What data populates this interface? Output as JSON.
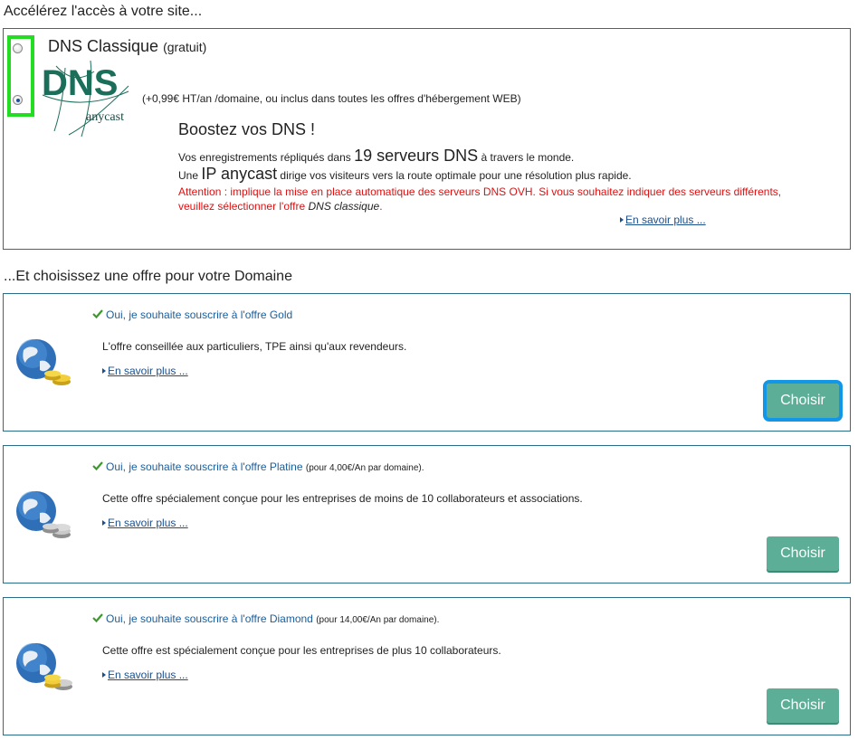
{
  "section1_title": "Accélérez l'accès à votre site...",
  "dns": {
    "classic_label": "DNS Classique",
    "classic_free": "(gratuit)",
    "logo_text": "DNS",
    "logo_sub": "anycast",
    "anycast_price": "(+0,99€ HT/an /domaine, ou inclus dans toutes les offres d'hébergement WEB)",
    "boost_title": "Boostez vos DNS !",
    "line1_prefix": "Vos enregistrements répliqués dans",
    "line1_big": "19 serveurs DNS",
    "line1_suffix": "à travers le monde.",
    "line2_prefix": "Une",
    "line2_big": "IP anycast",
    "line2_suffix": "dirige vos visiteurs vers la route optimale pour une résolution plus rapide.",
    "warn1": "Attention : implique la mise en place automatique des serveurs DNS OVH. Si vous souhaitez indiquer des serveurs différents,",
    "warn2_prefix": "veuillez sélectionner l'offre",
    "warn2_em": "DNS classique",
    "warn2_suffix": ".",
    "more": "En savoir plus ...",
    "selected": "anycast"
  },
  "section2_title": "...Et choisissez une offre pour votre Domaine",
  "offers": [
    {
      "subscribe": "Oui, je souhaite souscrire à l'offre Gold",
      "price": "",
      "description": "L'offre conseillée aux particuliers, TPE ainsi qu'aux revendeurs.",
      "more": "En savoir plus ...",
      "button": "Choisir"
    },
    {
      "subscribe": "Oui, je souhaite souscrire à l'offre Platine",
      "price": "(pour 4,00€/An par domaine).",
      "description": "Cette offre spécialement conçue pour les entreprises de moins de 10 collaborateurs et associations.",
      "more": "En savoir plus ...",
      "button": "Choisir"
    },
    {
      "subscribe": "Oui, je souhaite souscrire à l'offre Diamond",
      "price": "(pour 14,00€/An par domaine).",
      "description": "Cette offre est spécialement conçue pour les entreprises de plus 10 collaborateurs.",
      "more": "En savoir plus ...",
      "button": "Choisir"
    }
  ],
  "colors": {
    "accent_button": "#5cae96",
    "link": "#1a4e8c",
    "warning": "#dd1111",
    "border": "#2a6e8a",
    "focus_blue": "#1196e8",
    "highlight_green": "#22dd22"
  },
  "icons": [
    "radio-icon",
    "dns-anycast-logo",
    "check-icon",
    "arrow-icon",
    "globe-coins-gold-icon",
    "globe-coins-silver-icon",
    "globe-coins-mixed-icon"
  ]
}
